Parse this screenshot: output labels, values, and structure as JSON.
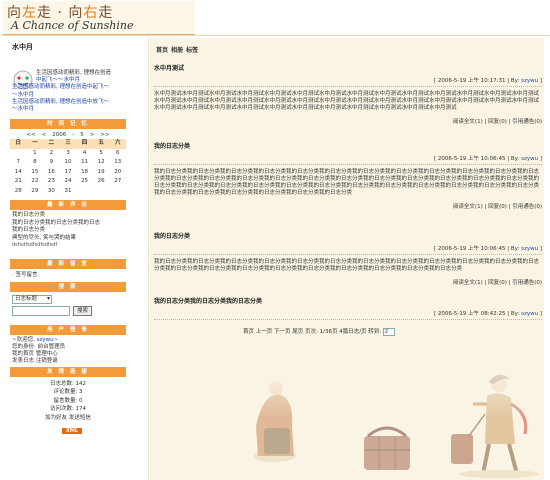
{
  "logo": {
    "cn_a": "向",
    "cn_b": "左",
    "cn_c": "走 · 向",
    "cn_d": "右",
    "cn_e": "走",
    "en": "A Chance of Sunshine"
  },
  "site_title": "水中月",
  "user": {
    "line1": "生活因感动而精彩, 理想在创造",
    "line2": "中起飞～～水中月",
    "line3": "生活因感动而精彩, 理想在创造中起飞～",
    "line4": "～水中月",
    "line5": "生活因感动而精彩, 理想在创造中放飞～",
    "line6": "～水中月"
  },
  "calendar": {
    "title": "时 间 记 忆",
    "prev_year": "<<",
    "prev_month": "<",
    "year": "2006",
    "sep": "-",
    "month": "5",
    "next_month": ">",
    "next_year": ">>",
    "weekdays": [
      "日",
      "一",
      "二",
      "三",
      "四",
      "五",
      "六"
    ],
    "weeks": [
      [
        "",
        "1",
        "2",
        "3",
        "4",
        "5",
        "6"
      ],
      [
        "7",
        "8",
        "9",
        "10",
        "11",
        "12",
        "13"
      ],
      [
        "14",
        "15",
        "16",
        "17",
        "18",
        "19",
        "20"
      ],
      [
        "21",
        "22",
        "23",
        "24",
        "25",
        "26",
        "27"
      ],
      [
        "28",
        "29",
        "30",
        "31",
        "",
        "",
        ""
      ]
    ]
  },
  "comments": {
    "title": "最 新 评 论",
    "items": [
      "我的日志分类",
      "我的日志分类我的日志分类我的日志",
      "我的日志分类",
      "典型的尽头, 笑与哭的结果",
      "dsfsdfsdfsdfsdfsdf"
    ]
  },
  "guestbook": {
    "title": "最 新 留 言",
    "link": "签写留言"
  },
  "search": {
    "title": "搜 索",
    "select": "日志标题",
    "button": "搜索"
  },
  "login": {
    "title": "用 户 登 录",
    "l1": "~欢迎您, ",
    "l2": "szywu~",
    "l3": "您的身份: 前台管理员",
    "l4": "我的首页  管理中心",
    "l5": "发表日志  注销登录"
  },
  "links": {
    "title": "友 情 连 接",
    "stats": [
      "日志总数: 142",
      "评论数量: 3",
      "留言数量: 0",
      "访问次数: 174",
      "加为好友  发送短信"
    ],
    "xml": "XML"
  },
  "topnav": "首页 相册 标签",
  "posts": [
    {
      "title": "水中月测试",
      "meta_pre": "[ 2006-5-19 上午 10:17:31 | By: ",
      "author": "szywu",
      "meta_post": " ]",
      "body": "水中月测试水中月测试水中月测试水中月测试水中月测试水中月测试水中月测试水中月测试水中月测试水中月测试水中月测试水中月测试水中月测试水中月测试水中月测试水中月测试水中月测试水中月测试水中月测试水中月测试水中月测试水中月测试水中月测试水中月测试水中月测试水中月测试水中月测试水中月测试水中月测试水中月测试水中月测试水中月测试水中月测试水中月测试水中月测试水中月测试水中月测试水中月测试水中月测试",
      "foot": "阅读全文(1) | 回复(0) | 引用通告(0)"
    },
    {
      "title": "我的日志分类",
      "meta_pre": "[ 2006-5-19 上午 10:06:45 | By: ",
      "author": "szywu",
      "meta_post": " ]",
      "body": "我的日志分类我的日志分类我的日志分类我的日志分类我的日志分类我的日志分类我的日志分类我的日志分类我的日志分类我的日志分类我的日志分类我的日志分类我的日志分类我的日志分类我的日志分类我的日志分类我的日志分类我的日志分类我的日志分类我的日志分类我的日志分类我的日志分类我的日志分类我的日志分类我的日志分类我的日志分类我的日志分类我的日志分类我的日志分类我的日志分类我的日志分类我的日志分类我的日志分类我的日志分类我的日志分类我的日志分类我的日志分类我的日志分类我的日志分类我的日志分类我的日志分类",
      "foot": "阅读全文(1) | 回复(0) | 引用通告(0)"
    },
    {
      "title": "我的日志分类",
      "meta_pre": "[ 2006-5-19 上午 10:06:45 | By: ",
      "author": "szywu",
      "meta_post": " ]",
      "body": "我的日志分类我的日志分类我的日志分类我的日志分类我的日志分类我的日志分类我的日志分类我的日志分类我的日志分类我的日志分类我的日志分类我的日志分类我的日志分类我的日志分类我的日志分类我的日志分类我的日志分类我的日志分类我的日志分类我的日志分类我的日志分类",
      "foot": "阅读全文(1) | 回复(0) | 引用通告(0)"
    },
    {
      "title": "我的日志分类我的日志分类我的日志分类",
      "meta_pre": "[ 2006-5-19 上午 08:42:25 | By: ",
      "author": "szywu",
      "meta_post": " ]",
      "body": "",
      "foot": ""
    }
  ],
  "pager": {
    "text": "首页 上一页 下一页 尾页 页次: 1/36页  4篇日志/页 转到: ",
    "page": "2"
  }
}
